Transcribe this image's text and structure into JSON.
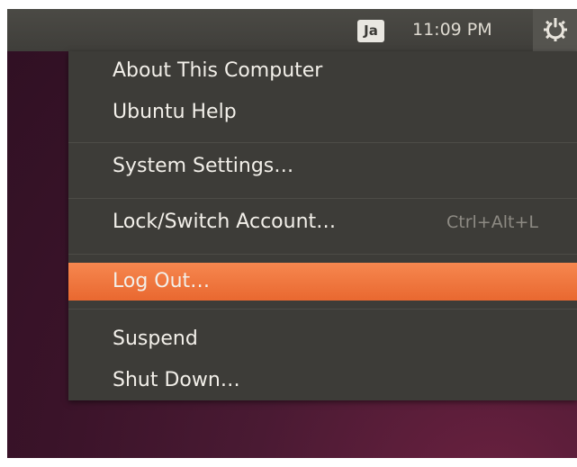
{
  "top_panel": {
    "keyboard_indicator": "Ja",
    "clock": "11:09 PM",
    "system_icon": "gear-power-icon"
  },
  "menu": {
    "about": "About This Computer",
    "help": "Ubuntu Help",
    "settings": "System Settings…",
    "lock": "Lock/Switch Account…",
    "lock_shortcut": "Ctrl+Alt+L",
    "logout": "Log Out…",
    "suspend": "Suspend",
    "shutdown": "Shut Down…",
    "highlighted_item": "Log Out…"
  },
  "colors": {
    "panel": "#3f3e3a",
    "menu_bg": "#3d3c38",
    "highlight": "#ef7a40",
    "desktop": "#3a1329"
  }
}
